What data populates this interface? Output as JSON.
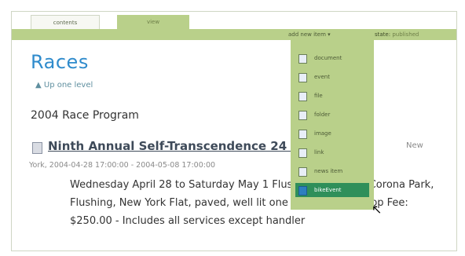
{
  "tabs": [
    {
      "label": "contents"
    },
    {
      "label": "view"
    }
  ],
  "toolbar": {
    "add_new_label": "add new item ▾",
    "state_label": "state:",
    "state_value": "published"
  },
  "page": {
    "title": "Races",
    "up_link": "▲ Up one level",
    "program": "2004 Race Program"
  },
  "item": {
    "title": "Ninth Annual Self-Transcendence 24 Hour Race",
    "location": "New",
    "meta": "York, 2004-04-28 17:00:00 - 2004-05-08 17:00:00",
    "description": "Wednesday April 28 to Saturday May 1 Flushing Meadows Corona Park, Flushing, New York Flat, paved, well lit one mile certified loop Fee: $250.00 - Includes all services except handler"
  },
  "add_menu": {
    "items": [
      {
        "label": "document",
        "icon": "document-icon"
      },
      {
        "label": "event",
        "icon": "event-icon"
      },
      {
        "label": "file",
        "icon": "file-icon"
      },
      {
        "label": "folder",
        "icon": "folder-icon"
      },
      {
        "label": "image",
        "icon": "image-icon"
      },
      {
        "label": "link",
        "icon": "link-icon"
      },
      {
        "label": "news item",
        "icon": "news-item-icon"
      },
      {
        "label": "bikeEvent",
        "icon": "bike-event-icon",
        "selected": true
      }
    ]
  },
  "colors": {
    "accent_green": "#b9d08a",
    "title_blue": "#2f8bcc",
    "selected_item": "#2f8f5a"
  }
}
